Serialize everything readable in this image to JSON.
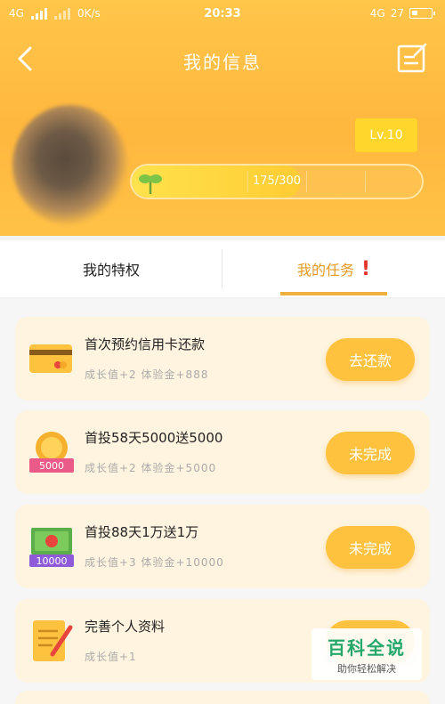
{
  "status_bar": {
    "network_left": "4G",
    "speed": "0K/s",
    "time": "20:33",
    "network_right": "4G",
    "battery": "27"
  },
  "header": {
    "title": "我的信息",
    "level_badge": "Lv.10",
    "progress_text": "175/300",
    "progress_fraction": 0.5833,
    "colors": {
      "accent": "#ffb73e",
      "badge": "#ffd62b"
    }
  },
  "tabs": {
    "privileges": "我的特权",
    "tasks": "我的任务",
    "tasks_alert": "!"
  },
  "tasks": [
    {
      "title": "首次预约信用卡还款",
      "reward": "成长值+2 体验金+888",
      "button": "去还款",
      "icon": "credit-card-icon"
    },
    {
      "title": "首投58天5000送5000",
      "reward": "成长值+2 体验金+5000",
      "button": "未完成",
      "icon": "coin-5000-icon",
      "icon_label": "5000"
    },
    {
      "title": "首投88天1万送1万",
      "reward": "成长值+3 体验金+10000",
      "button": "未完成",
      "icon": "cash-10000-icon",
      "icon_label": "10000"
    },
    {
      "title": "完善个人资料",
      "reward": "成长值+1",
      "button": "",
      "icon": "notepad-pencil-icon"
    }
  ],
  "watermark": {
    "main": "百科全说",
    "sub": "助你轻松解决"
  }
}
